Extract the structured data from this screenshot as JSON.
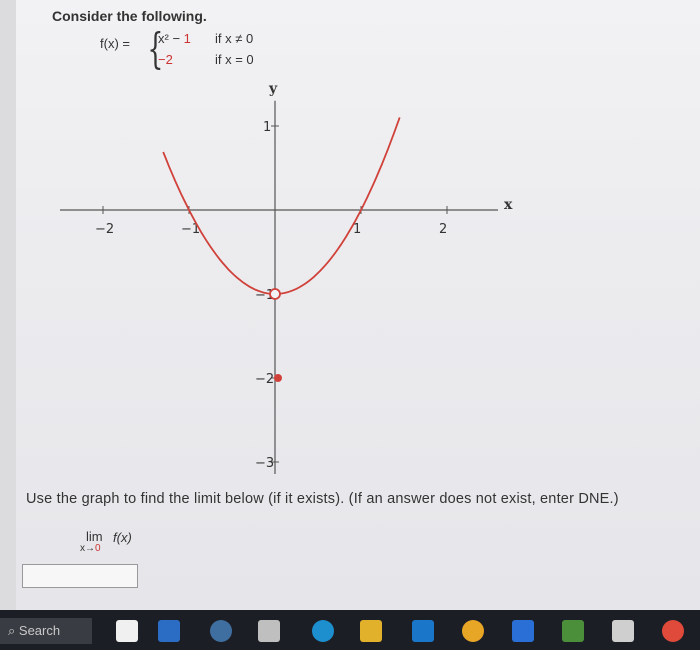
{
  "problem": {
    "prompt": "Consider the following.",
    "function_lhs": "f(x) =",
    "piece1_expr": "x² − ",
    "piece1_const": "1",
    "piece1_cond": "if x ≠ 0",
    "piece2_value": "−2",
    "piece2_cond": "if x = 0"
  },
  "chart_data": {
    "type": "line",
    "title": "",
    "xlabel": "x",
    "ylabel": "y",
    "xlim": [
      -2.5,
      2.5
    ],
    "ylim": [
      -3,
      1.3
    ],
    "x_ticks": [
      -2,
      -1,
      1,
      2
    ],
    "x_tick_labels": [
      "−2",
      "−1",
      "1",
      "2"
    ],
    "y_ticks": [
      1,
      -1,
      -2,
      -3
    ],
    "y_tick_labels": [
      "1",
      "−1",
      "−2",
      "−3"
    ],
    "series": [
      {
        "x": [
          -1.3,
          -1.0,
          -0.5,
          0.0,
          0.5,
          1.0,
          1.45
        ],
        "y": [
          0.69,
          0.0,
          -0.75,
          -1.0,
          -0.75,
          0.0,
          1.1
        ],
        "color": "#d0413a"
      }
    ],
    "points": [
      {
        "x": 0,
        "y": -1,
        "style": "open"
      },
      {
        "x": 0,
        "y": -2,
        "style": "filled"
      }
    ]
  },
  "question": {
    "text": "Use the graph to find the limit below (if it exists). (If an answer does not exist, enter DNE.)",
    "lim_label": "lim",
    "lim_sub_x": "x→",
    "lim_sub_zero": "0",
    "lim_expr": "f(x)",
    "answer_value": ""
  },
  "taskbar": {
    "search_label": "Search"
  }
}
